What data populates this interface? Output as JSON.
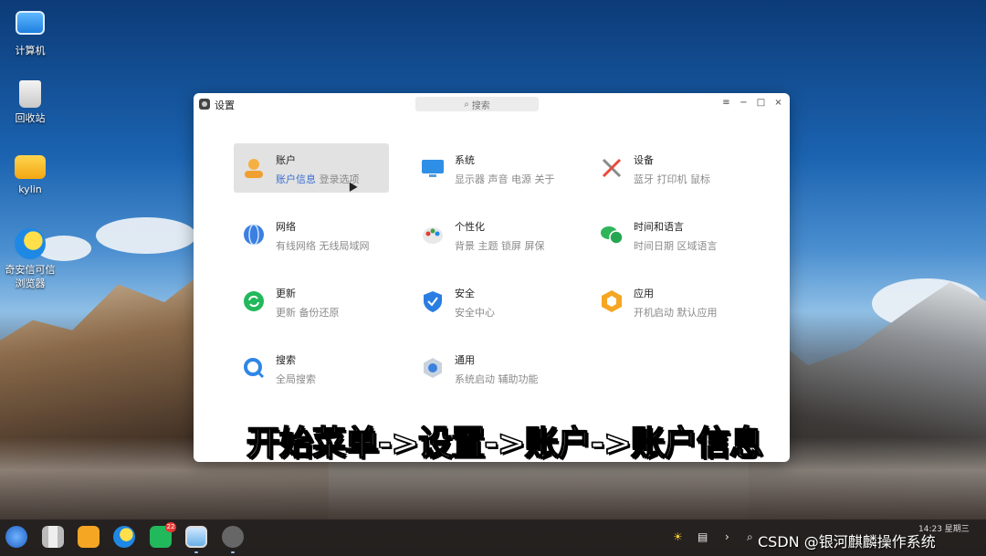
{
  "desktop": {
    "icons": [
      {
        "label": "计算机"
      },
      {
        "label": "回收站"
      },
      {
        "label": "kylin"
      },
      {
        "label_line1": "奇安信可信",
        "label_line2": "浏览器"
      }
    ]
  },
  "window": {
    "title": "设置",
    "search_placeholder": "搜索",
    "items": [
      {
        "name": "账户",
        "sub_highlight": "账户信息",
        "sub": "登录选项"
      },
      {
        "name": "系统",
        "sub": "显示器 声音 电源 关于"
      },
      {
        "name": "设备",
        "sub": "蓝牙 打印机 鼠标"
      },
      {
        "name": "网络",
        "sub": "有线网络 无线局域网"
      },
      {
        "name": "个性化",
        "sub": "背景 主题 锁屏 屏保"
      },
      {
        "name": "时间和语言",
        "sub": "时间日期 区域语言"
      },
      {
        "name": "更新",
        "sub": "更新 备份还原"
      },
      {
        "name": "安全",
        "sub": "安全中心"
      },
      {
        "name": "应用",
        "sub": "开机启动 默认应用"
      },
      {
        "name": "搜索",
        "sub": "全局搜索"
      },
      {
        "name": "通用",
        "sub": "系统启动 辅助功能"
      }
    ]
  },
  "caption": "开始菜单->设置->账户->账户信息",
  "taskbar": {
    "badge": "22",
    "clock": "14:23 星期三"
  },
  "watermark": "CSDN @银河麒麟操作系统",
  "colors": {
    "accent": "#3b6fd1"
  }
}
